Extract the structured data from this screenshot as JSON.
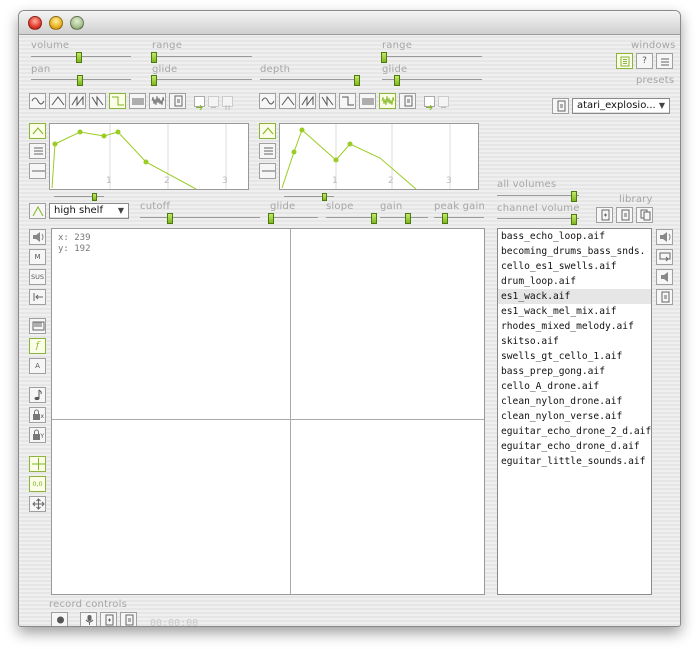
{
  "window": {
    "title": ""
  },
  "labels": {
    "volume": "volume",
    "range1": "range",
    "range2": "range",
    "windows": "windows",
    "pan": "pan",
    "glide1": "glide",
    "depth": "depth",
    "glide2": "glide",
    "presets": "presets",
    "all_volumes": "all volumes",
    "channel_volume": "channel volume",
    "library": "library",
    "cutoff": "cutoff",
    "glide3": "glide",
    "slope": "slope",
    "gain": "gain",
    "peak_gain": "peak gain",
    "record_controls": "record controls"
  },
  "envelope1": {
    "ticks": [
      "1",
      "2",
      "3"
    ]
  },
  "envelope2": {
    "ticks": [
      "1",
      "2",
      "3"
    ]
  },
  "filter": {
    "type": "high shelf"
  },
  "preset": {
    "selected": "atari_explosio..."
  },
  "xy_pad": {
    "x_label": "x: 239",
    "y_label": "y: 192"
  },
  "record": {
    "time": "00:00:00"
  },
  "library": {
    "selected_index": 4,
    "items": [
      "bass_echo_loop.aif",
      "becoming_drums_bass_snds.",
      "cello_es1_swells.aif",
      "drum_loop.aif",
      "es1_wack.aif",
      "es1_wack_mel_mix.aif",
      "rhodes_mixed_melody.aif",
      "skitso.aif",
      "swells_gt_cello_1.aif",
      "bass_prep_gong.aif",
      "cello_A_drone.aif",
      "clean_nylon_drone.aif",
      "clean_nylon_verse.aif",
      "eguitar_echo_drone_2_d.aif",
      "eguitar_echo_drone_d.aif",
      "eguitar_little_sounds.aif"
    ]
  },
  "left_tools": {
    "m": "M",
    "sus": "SUS",
    "a": "A",
    "x": "x",
    "y": "Y",
    "zero": "0,0"
  },
  "colors": {
    "accent": "#9bcc24",
    "knob": "#8fc42a"
  }
}
